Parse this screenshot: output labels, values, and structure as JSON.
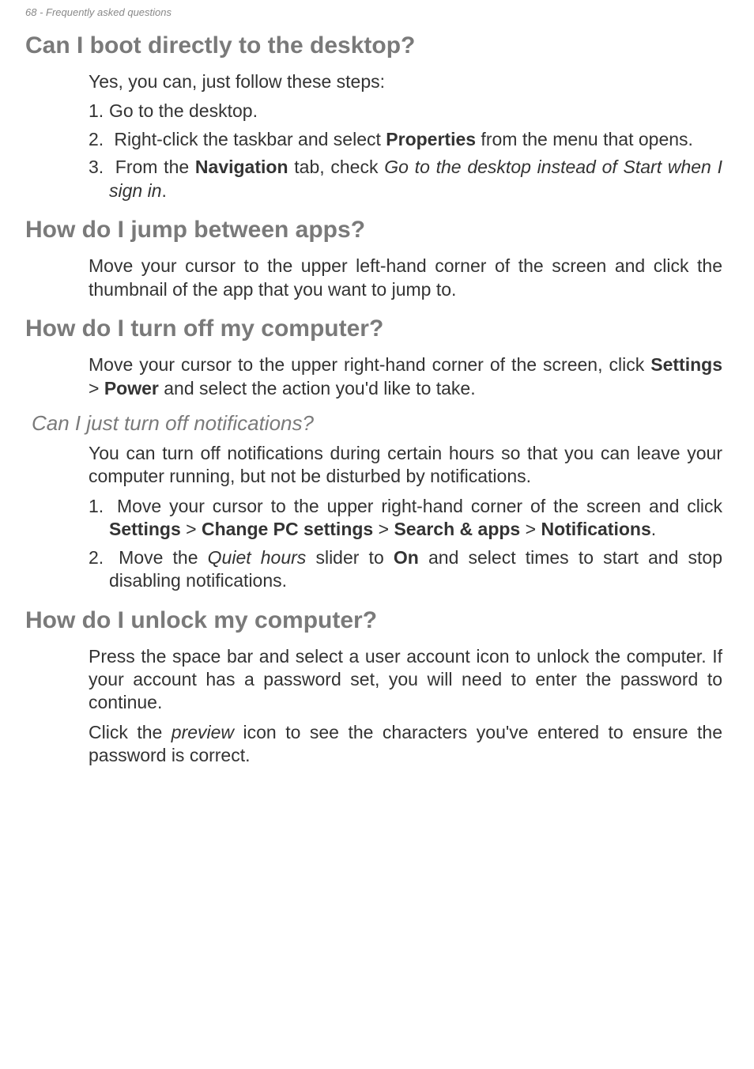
{
  "header": "68 - Frequently asked questions",
  "s1": {
    "title": "Can I boot directly to the desktop?",
    "intro": "Yes, you can, just follow these steps:",
    "step1": "Go to the desktop.",
    "step2a": "Right-click the taskbar and select ",
    "step2b": "Properties",
    "step2c": " from the menu that opens.",
    "step3a": "From the ",
    "step3b": "Navigation",
    "step3c": " tab, check ",
    "step3d": "Go to the desktop instead of Start when I sign in",
    "step3e": "."
  },
  "s2": {
    "title": "How do I jump between apps?",
    "p": "Move your cursor to the upper left-hand corner of the screen and click the thumbnail of the app that you want to jump to."
  },
  "s3": {
    "title": "How do I turn off my computer?",
    "pa": "Move your cursor to the upper right-hand corner of the screen, click ",
    "pb": "Settings",
    "pc": " > ",
    "pd": "Power",
    "pe": " and select the action you'd like to take."
  },
  "s3sub": {
    "title": "Can I just turn off notifications?",
    "p": "You can turn off notifications during certain hours so that you can leave your computer running, but not be disturbed by notifications.",
    "step1a": "Move your cursor to the upper right-hand corner of the screen and click ",
    "step1b": "Settings",
    "step1c": " > ",
    "step1d": "Change PC settings",
    "step1e": " > ",
    "step1f": "Search & apps",
    "step1g": " > ",
    "step1h": "Notifications",
    "step1i": ".",
    "step2a": "Move the ",
    "step2b": "Quiet hours",
    "step2c": " slider to ",
    "step2d": "On",
    "step2e": " and select times to start and stop disabling notifications."
  },
  "s4": {
    "title": "How do I unlock my computer?",
    "p1": "Press the space bar and select a user account icon to unlock the computer. If your account has a password set, you will need to enter the password to continue.",
    "p2a": "Click the ",
    "p2b": "preview",
    "p2c": " icon to see the characters you've entered to ensure the password is correct."
  }
}
